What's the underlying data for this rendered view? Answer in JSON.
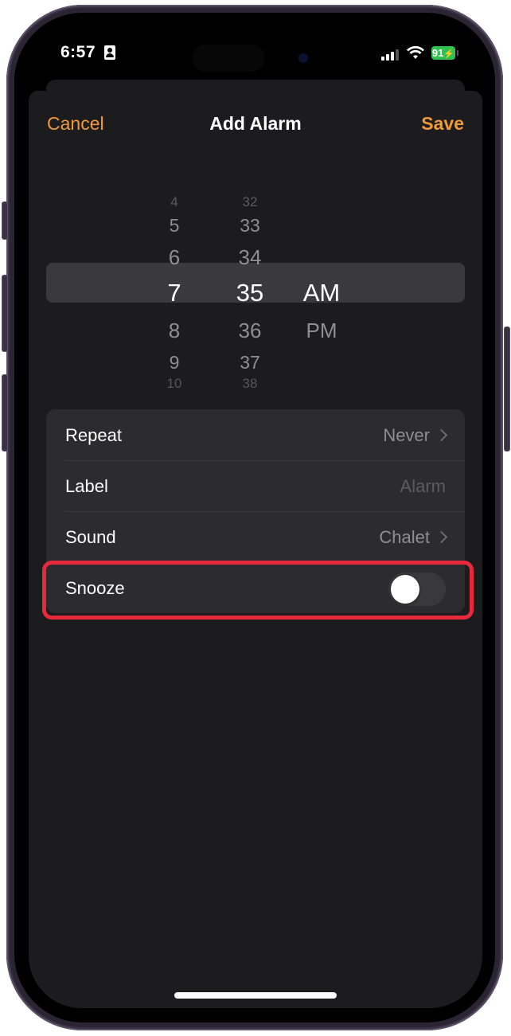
{
  "status_bar": {
    "time": "6:57",
    "battery_level": "91",
    "battery_color": "#30c251",
    "icons": [
      "person-badge-icon",
      "cellular-signal-icon",
      "wifi-icon",
      "battery-charging-icon"
    ]
  },
  "nav": {
    "cancel_label": "Cancel",
    "title": "Add Alarm",
    "save_label": "Save",
    "accent_color": "#f09a37"
  },
  "picker": {
    "hours": [
      "4",
      "5",
      "6",
      "7",
      "8",
      "9",
      "10"
    ],
    "minutes": [
      "32",
      "33",
      "34",
      "35",
      "36",
      "37",
      "38"
    ],
    "periods": [
      "AM",
      "PM"
    ],
    "selected_hour": "7",
    "selected_minute": "35",
    "selected_period": "AM"
  },
  "settings": {
    "repeat": {
      "label": "Repeat",
      "value": "Never"
    },
    "label": {
      "label": "Label",
      "placeholder": "Alarm"
    },
    "sound": {
      "label": "Sound",
      "value": "Chalet"
    },
    "snooze": {
      "label": "Snooze",
      "enabled": false
    }
  },
  "annotation": {
    "highlight_color": "#e8283c",
    "target": "Snooze"
  }
}
